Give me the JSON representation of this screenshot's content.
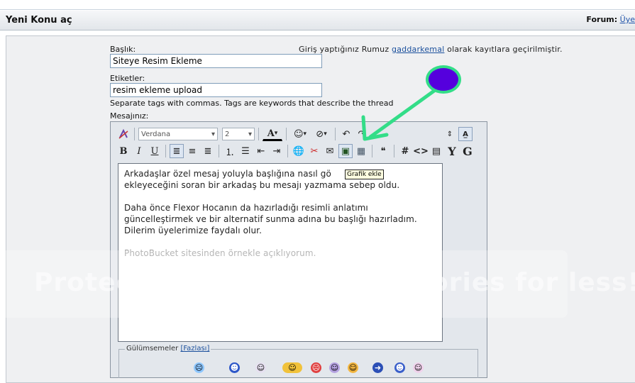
{
  "header": {
    "title": "Yeni Konu aç",
    "forum_label": "Forum:",
    "forum_link": "Üye"
  },
  "form": {
    "title_label": "Başlık:",
    "title_value": "Siteye Resim Ekleme",
    "login_prefix": "Giriş yaptığınız Rumuz",
    "login_user": "gaddarkemal",
    "login_suffix": "olarak kayıtlara geçirilmiştir.",
    "tags_label": "Etiketler:",
    "tags_value": "resim ekleme upload",
    "tags_hint": "Separate tags with commas. Tags are keywords that describe the thread",
    "message_label": "Mesajınız:"
  },
  "editor": {
    "font_select": "Verdana",
    "size_select": "2",
    "tooltip": "Grafik ekle",
    "paragraph1": "Arkadaşlar özel mesaj yoluyla başlığına nasıl gö",
    "paragraph1_tail": "m",
    "paragraph1_line2": "ekleyeceğini soran bir arkadaş bu mesajı yazmama sebep oldu.",
    "paragraph2": "Daha önce Flexor Hocanın da hazırladığı resimli anlatımı güncelleştirmek ve bir alternatif sunma adına bu başlığı hazırladım. Dilerim üyelerimize faydalı olur.",
    "paragraph3": "PhotoBucket sitesinden örnekle açıklıyorum.",
    "text_color_glyph": "A",
    "bold": "B",
    "italic": "I",
    "underline": "U",
    "hash": "#",
    "code": "<>",
    "y_glyph": "Y",
    "g_glyph": "G",
    "undo_glyph": "↶"
  },
  "smilies": {
    "legend": "Gülümsemeler",
    "more": "[Fazlası]"
  },
  "watermark": {
    "text": "Protect more of your memories for less!"
  },
  "colors": {
    "accent_green": "#33dd88",
    "circle_fill": "#5500dd"
  }
}
